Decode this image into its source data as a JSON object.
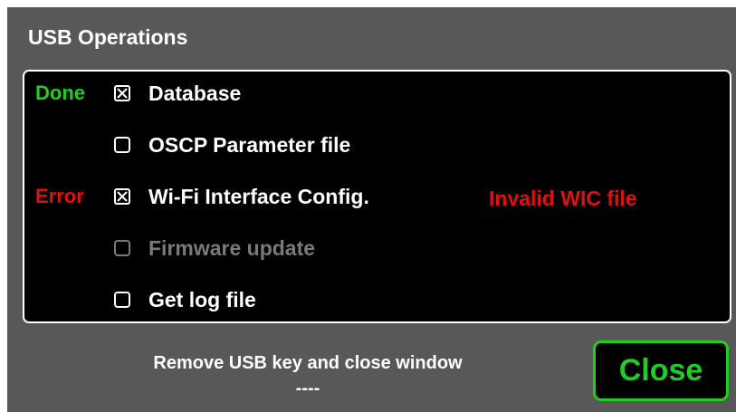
{
  "window": {
    "title": "USB Operations"
  },
  "operations": [
    {
      "status": "Done",
      "status_color": "#22cc22",
      "label": "Database",
      "checked": true,
      "enabled": true,
      "message": ""
    },
    {
      "status": "",
      "status_color": "",
      "label": "OSCP Parameter file",
      "checked": false,
      "enabled": true,
      "message": ""
    },
    {
      "status": "Error",
      "status_color": "#e01010",
      "label": "Wi-Fi Interface Config.",
      "checked": true,
      "enabled": true,
      "message": "Invalid WIC file"
    },
    {
      "status": "",
      "status_color": "",
      "label": "Firmware update",
      "checked": false,
      "enabled": false,
      "message": ""
    },
    {
      "status": "",
      "status_color": "",
      "label": "Get log file",
      "checked": false,
      "enabled": true,
      "message": ""
    }
  ],
  "footer": {
    "instruction": "Remove USB key and close window",
    "progress": "----",
    "close_label": "Close"
  },
  "colors": {
    "background": "#585858",
    "panel": "#000000",
    "done": "#22cc22",
    "error": "#e01010",
    "disabled": "#7a7a7a",
    "close_accent": "#22cc22"
  }
}
